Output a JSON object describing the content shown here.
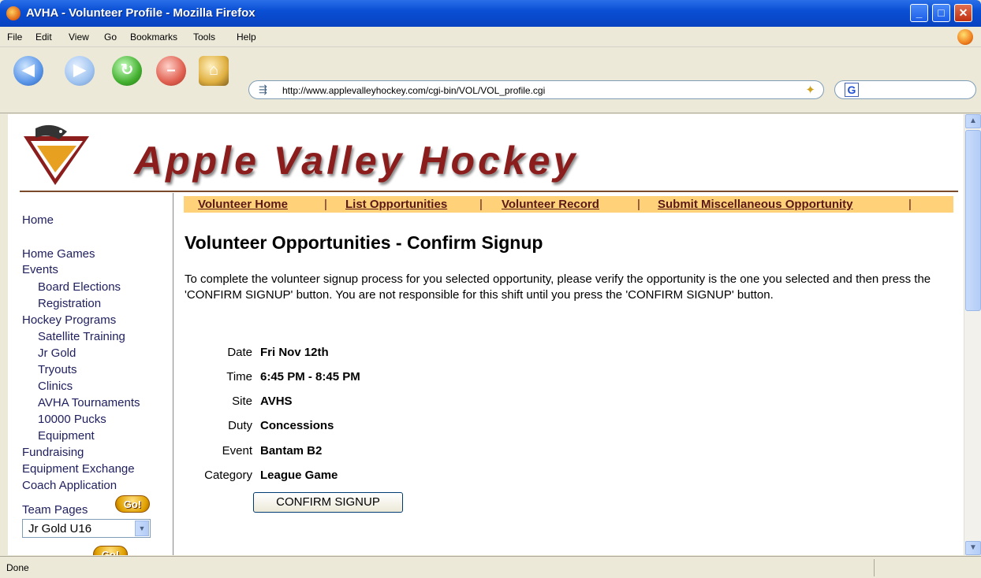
{
  "window": {
    "title": "AVHA - Volunteer Profile - Mozilla Firefox"
  },
  "menu": [
    "File",
    "Edit",
    "View",
    "Go",
    "Bookmarks",
    "Tools",
    "Help"
  ],
  "nav": {
    "url": "http://www.applevalleyhockey.com/cgi-bin/VOL/VOL_profile.cgi",
    "search_engine": "G"
  },
  "banner": {
    "text": "Apple Valley Hockey"
  },
  "sidebar": {
    "items": [
      {
        "label": "Home"
      },
      {
        "label": "Home Games"
      },
      {
        "label": "Events"
      },
      {
        "label": "Board Elections"
      },
      {
        "label": "Registration"
      },
      {
        "label": "Hockey Programs"
      },
      {
        "label": "Satellite Training"
      },
      {
        "label": "Jr Gold"
      },
      {
        "label": "Tryouts"
      },
      {
        "label": "Clinics"
      },
      {
        "label": "AVHA Tournaments"
      },
      {
        "label": "10000 Pucks"
      },
      {
        "label": "Equipment"
      },
      {
        "label": "Fundraising"
      },
      {
        "label": "Equipment Exchange"
      },
      {
        "label": "Coach Application"
      }
    ],
    "team_pages_label": "Team Pages",
    "go_label": "Go!",
    "team_select_value": "Jr Gold U16"
  },
  "subnav": {
    "links": [
      "Volunteer Home",
      "List Opportunities",
      "Volunteer Record",
      "Submit Miscellaneous Opportunity"
    ],
    "separator": "|"
  },
  "main": {
    "title": "Volunteer Opportunities - Confirm Signup",
    "intro": "To complete the volunteer signup process for you selected opportunity, please verify the opportunity is the one you selected and then press the 'CONFIRM SIGNUP' button. You are not responsible for this shift until you press the 'CONFIRM SIGNUP' button.",
    "details": [
      {
        "label": "Date",
        "value": "Fri Nov 12th"
      },
      {
        "label": "Time",
        "value": "6:45 PM - 8:45 PM"
      },
      {
        "label": "Site",
        "value": "AVHS"
      },
      {
        "label": "Duty",
        "value": "Concessions"
      },
      {
        "label": "Event",
        "value": "Bantam B2"
      },
      {
        "label": "Category",
        "value": "League Game"
      }
    ],
    "confirm_label": "CONFIRM SIGNUP"
  },
  "status": {
    "text": "Done"
  }
}
